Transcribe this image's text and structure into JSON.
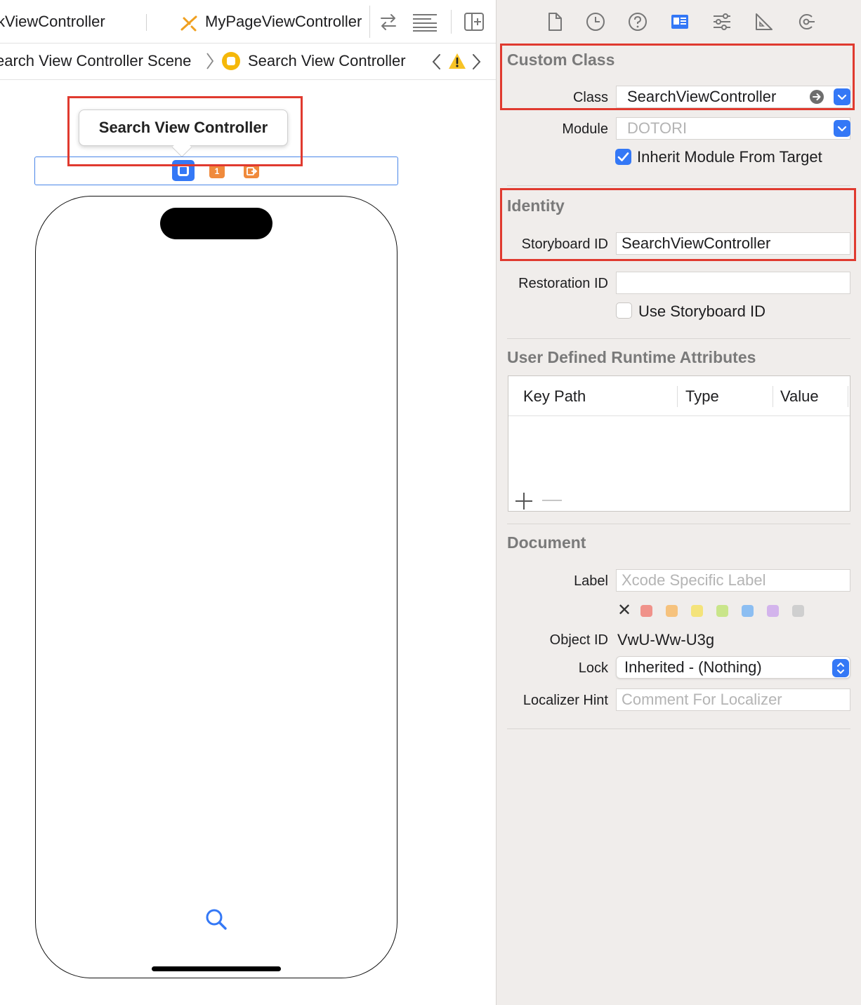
{
  "editor": {
    "tabs": [
      {
        "label": "kViewController"
      },
      {
        "label": "MyPageViewController"
      }
    ],
    "jumpbar": {
      "scene": "earch View Controller Scene",
      "controller": "Search View Controller"
    },
    "canvas": {
      "tooltip": "Search View Controller",
      "dock_first_responder_badge": "1"
    }
  },
  "inspector": {
    "custom_class": {
      "title": "Custom Class",
      "class_label": "Class",
      "class_value": "SearchViewController",
      "module_label": "Module",
      "module_placeholder": "DOTORI",
      "inherit_label": "Inherit Module From Target",
      "inherit_checked": true
    },
    "identity": {
      "title": "Identity",
      "storyboard_id_label": "Storyboard ID",
      "storyboard_id_value": "SearchViewController",
      "restoration_id_label": "Restoration ID",
      "restoration_id_value": "",
      "use_storyboard_id_label": "Use Storyboard ID",
      "use_storyboard_id_checked": false
    },
    "runtime_attributes": {
      "title": "User Defined Runtime Attributes",
      "columns": [
        "Key Path",
        "Type",
        "Value"
      ],
      "rows": []
    },
    "document": {
      "title": "Document",
      "label_label": "Label",
      "label_placeholder": "Xcode Specific Label",
      "swatch_colors": [
        "#f0928a",
        "#f6c27d",
        "#f4e37a",
        "#c9e58a",
        "#8cbef2",
        "#d3b4ec",
        "#cfcfcf"
      ],
      "object_id_label": "Object ID",
      "object_id_value": "VwU-Ww-U3g",
      "lock_label": "Lock",
      "lock_value": "Inherited - (Nothing)",
      "localizer_hint_label": "Localizer Hint",
      "localizer_hint_placeholder": "Comment For Localizer"
    }
  },
  "icons": {
    "inspector_tabs": [
      "file-icon",
      "history-icon",
      "help-icon",
      "identity-icon",
      "attributes-icon",
      "size-icon",
      "connections-icon"
    ]
  },
  "colors": {
    "accent": "#3478f6",
    "highlight_box": "#e03a2f",
    "inspector_bg": "#f0edeb"
  }
}
